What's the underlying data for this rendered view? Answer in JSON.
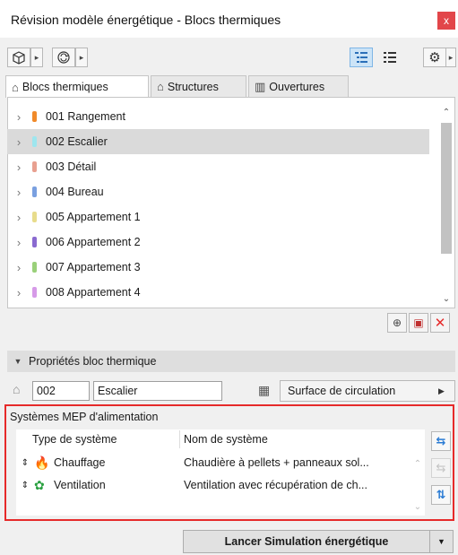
{
  "window": {
    "title": "Révision modèle énergétique - Blocs thermiques",
    "close_glyph": "x"
  },
  "toolbar": {
    "icons": [
      "building-icon",
      "refresh-icon",
      "tree-view-icon",
      "list-view-icon",
      "settings-icon"
    ]
  },
  "tabs": [
    {
      "label": "Blocs thermiques",
      "icon": "thermal-block-icon",
      "active": true
    },
    {
      "label": "Structures",
      "icon": "house-icon",
      "active": false
    },
    {
      "label": "Ouvertures",
      "icon": "window-icon",
      "active": false
    }
  ],
  "blocks": [
    {
      "label": "001 Rangement",
      "color": "#f08a2a",
      "selected": false
    },
    {
      "label": "002 Escalier",
      "color": "#9ee6ee",
      "selected": true
    },
    {
      "label": "003 Détail",
      "color": "#e8a090",
      "selected": false
    },
    {
      "label": "004 Bureau",
      "color": "#7aa0e0",
      "selected": false
    },
    {
      "label": "005 Appartement 1",
      "color": "#e8dc8c",
      "selected": false
    },
    {
      "label": "006 Appartement 2",
      "color": "#8a6ad0",
      "selected": false
    },
    {
      "label": "007 Appartement 3",
      "color": "#9ad07a",
      "selected": false
    },
    {
      "label": "008 Appartement 4",
      "color": "#d69ae8",
      "selected": false
    }
  ],
  "properties": {
    "section_title": "Propriétés bloc thermique",
    "id_value": "002",
    "name_value": "Escalier",
    "type_value": "Surface de circulation"
  },
  "mep": {
    "title": "Systèmes MEP d'alimentation",
    "col_type": "Type de système",
    "col_name": "Nom de système",
    "rows": [
      {
        "type": "Chauffage",
        "icon": "flame-icon",
        "name": "Chaudière à pellets + panneaux sol..."
      },
      {
        "type": "Ventilation",
        "icon": "fan-icon",
        "name": "Ventilation avec récupération de ch..."
      }
    ]
  },
  "footer": {
    "run_label": "Lancer Simulation énergétique"
  },
  "colors": {
    "accent": "#2a7bd4",
    "highlight_border": "#e62a2a",
    "close_bg": "#e2464a"
  }
}
